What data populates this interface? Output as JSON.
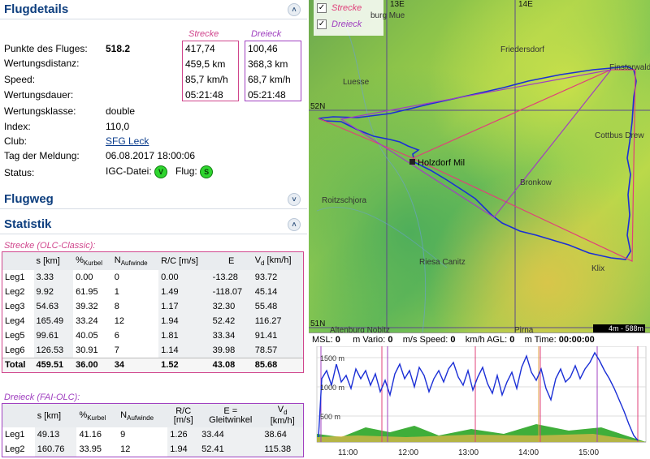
{
  "sections": {
    "flugdetails": "Flugdetails",
    "flugweg": "Flugweg",
    "statistik": "Statistik"
  },
  "details": {
    "rows": [
      {
        "label": "Punkte des Fluges:",
        "value": "518.2"
      },
      {
        "label": "Wertungsdistanz:",
        "value": ""
      },
      {
        "label": "Speed:",
        "value": ""
      },
      {
        "label": "Wertungsdauer:",
        "value": ""
      },
      {
        "label": "Wertungsklasse:",
        "value": "double"
      },
      {
        "label": "Index:",
        "value": "110,0"
      },
      {
        "label": "Club:",
        "value": "SFG Leck"
      },
      {
        "label": "Tag der Meldung:",
        "value": "06.08.2017 18:00:06"
      },
      {
        "label": "Status:",
        "value": ""
      }
    ],
    "status": {
      "igc_label": "IGC-Datei:",
      "flug_label": "Flug:",
      "igc_badge": "V",
      "flug_badge": "S"
    },
    "strecke": {
      "head": "Strecke",
      "values": [
        "417,74",
        "459,5 km",
        "85,7 km/h",
        "05:21:48"
      ]
    },
    "dreieck": {
      "head": "Dreieck",
      "values": [
        "100,46",
        "368,3 km",
        "68,7 km/h",
        "05:21:48"
      ]
    }
  },
  "strecke_table": {
    "caption": "Strecke (OLC-Classic):",
    "rows": [
      [
        "Leg1",
        "3.33",
        "0.00",
        "0",
        "0.00",
        "-13.28",
        "93.72"
      ],
      [
        "Leg2",
        "9.92",
        "61.95",
        "1",
        "1.49",
        "-118.07",
        "45.14"
      ],
      [
        "Leg3",
        "54.63",
        "39.32",
        "8",
        "1.17",
        "32.30",
        "55.48"
      ],
      [
        "Leg4",
        "165.49",
        "33.24",
        "12",
        "1.94",
        "52.42",
        "116.27"
      ],
      [
        "Leg5",
        "99.61",
        "40.05",
        "6",
        "1.81",
        "33.34",
        "91.41"
      ],
      [
        "Leg6",
        "126.53",
        "30.91",
        "7",
        "1.14",
        "39.98",
        "78.57"
      ]
    ],
    "total": [
      "Total",
      "459.51",
      "36.00",
      "34",
      "1.52",
      "43.08",
      "85.68"
    ]
  },
  "dreieck_table": {
    "caption": "Dreieck (FAI-OLC):",
    "rows": [
      [
        "Leg1",
        "49.13",
        "41.16",
        "9",
        "1.26",
        "33.44",
        "38.64"
      ],
      [
        "Leg2",
        "160.76",
        "33.95",
        "12",
        "1.94",
        "52.41",
        "115.38"
      ]
    ]
  },
  "table_headers": {
    "s": "s [km]",
    "kurbel": "%",
    "kurbel_sub": "Kurbel",
    "n": "N",
    "n_sub": "Aufwinde",
    "rc": "R/C [m/s]",
    "rc2": "R/C",
    "rc2b": "[m/s]",
    "e": "E",
    "e2": "E =",
    "e2b": "Gleitwinkel",
    "vd": "V",
    "vd_sub": "d",
    "vd_unit": " [km/h]",
    "vd_unit2": "[km/h]"
  },
  "map": {
    "legend": {
      "strecke": "Strecke",
      "dreieck": "Dreieck"
    },
    "places": [
      "burg Mue",
      "Friedersdorf",
      "Luesse",
      "Finsterwalde",
      "Cottbus Drew",
      "Holzdorf Mil",
      "Bronkow",
      "Roitzschjora",
      "Riesa Canitz",
      "Klix",
      "Altenburg Nobitz",
      "Pirna"
    ],
    "grid": {
      "e13": "13E",
      "e14": "14E",
      "n52": "52N",
      "n51": "51N"
    },
    "scale": "4m - 588m",
    "colors": {
      "strecke": "#e0407a",
      "dreieck": "#a040c0",
      "track": "#1b2fd6"
    }
  },
  "baro": {
    "status": {
      "msl": "MSL:",
      "msl_val": "0",
      "m_vario": "m Vario:",
      "vario_val": "0",
      "ms_speed": "m/s Speed:",
      "speed_val": "0",
      "kmh_agl": "km/h AGL:",
      "agl_val": "0",
      "m_time": "m Time:",
      "time_val": "00:00:00"
    },
    "alt_labels": [
      "1500 m",
      "1000 m",
      "500 m"
    ],
    "times": [
      "11:00",
      "12:00",
      "13:00",
      "14:00",
      "15:00"
    ]
  }
}
